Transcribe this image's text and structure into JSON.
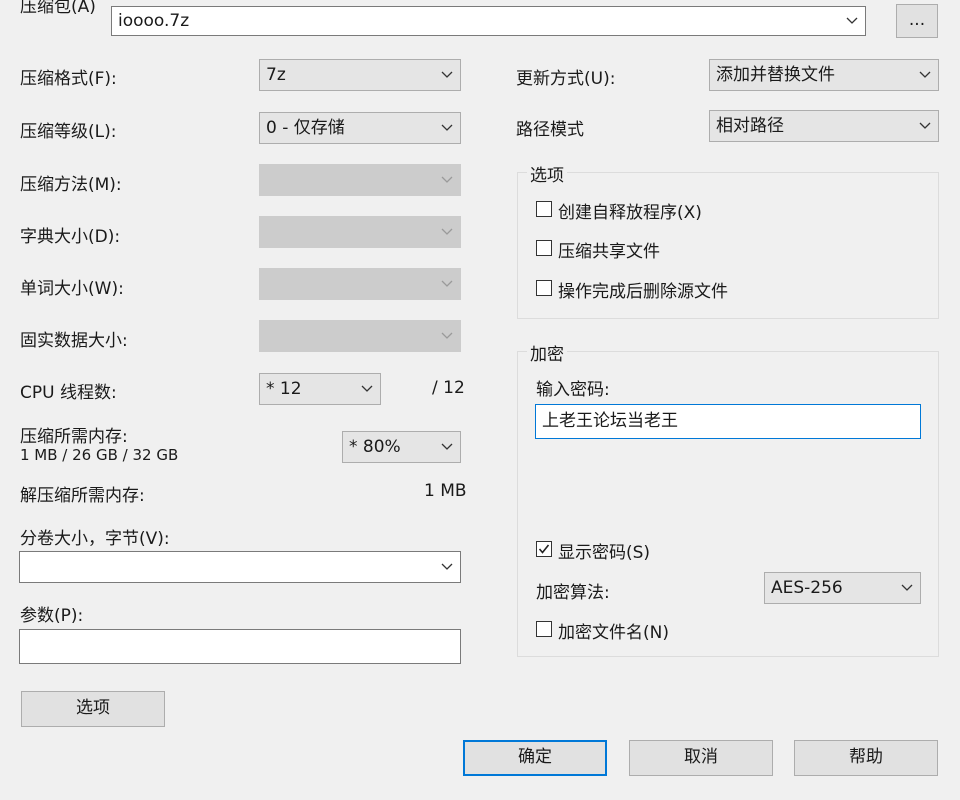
{
  "archive": {
    "label": "压缩包(A)",
    "value": "ioooo.7z",
    "browse_label": "..."
  },
  "left": {
    "format": {
      "label": "压缩格式(F):",
      "value": "7z"
    },
    "level": {
      "label": "压缩等级(L):",
      "value": "0 - 仅存储"
    },
    "method": {
      "label": "压缩方法(M):",
      "value": ""
    },
    "dict": {
      "label": "字典大小(D):",
      "value": ""
    },
    "word": {
      "label": "单词大小(W):",
      "value": ""
    },
    "solid": {
      "label": "固实数据大小:",
      "value": ""
    },
    "threads": {
      "label": "CPU 线程数:",
      "value": "* 12",
      "max": "/ 12"
    },
    "mem": {
      "label": "压缩所需内存:",
      "detail": "1 MB / 26 GB / 32 GB",
      "value": "* 80%"
    },
    "decomp": {
      "label": "解压缩所需内存:",
      "value": "1 MB"
    },
    "volume": {
      "label": "分卷大小，字节(V):",
      "value": ""
    },
    "params": {
      "label": "参数(P):",
      "value": ""
    },
    "options_button": "选项"
  },
  "right": {
    "update": {
      "label": "更新方式(U):",
      "value": "添加并替换文件"
    },
    "path": {
      "label": "路径模式",
      "value": "相对路径"
    },
    "options_group": {
      "title": "选项",
      "items": [
        {
          "label": "创建自释放程序(X)",
          "checked": false
        },
        {
          "label": "压缩共享文件",
          "checked": false
        },
        {
          "label": "操作完成后删除源文件",
          "checked": false
        }
      ]
    },
    "encryption": {
      "title": "加密",
      "password_label": "输入密码:",
      "password_value": "上老王论坛当老王",
      "show_password": {
        "label": "显示密码(S)",
        "checked": true
      },
      "method_label": "加密算法:",
      "method_value": "AES-256",
      "encrypt_names": {
        "label": "加密文件名(N)",
        "checked": false
      }
    }
  },
  "footer": {
    "ok": "确定",
    "cancel": "取消",
    "help": "帮助"
  }
}
